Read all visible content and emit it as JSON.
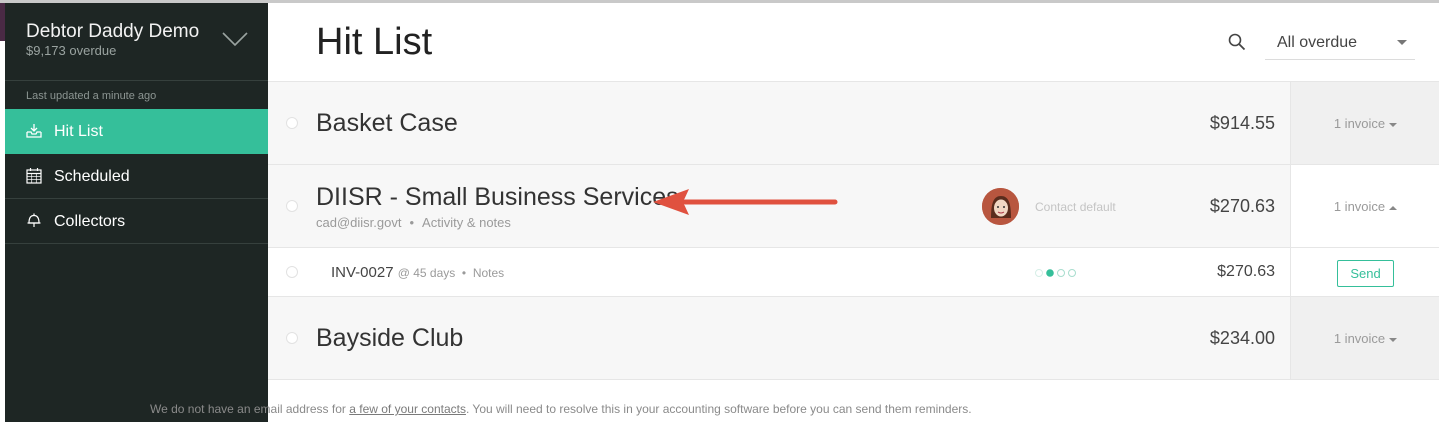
{
  "sidebar": {
    "org_name": "Debtor Daddy Demo",
    "org_overdue": "$9,173 overdue",
    "last_updated": "Last updated a minute ago",
    "items": [
      {
        "label": "Hit List",
        "icon": "inbox-icon",
        "active": true
      },
      {
        "label": "Scheduled",
        "icon": "calendar-icon",
        "active": false
      },
      {
        "label": "Collectors",
        "icon": "bell-icon",
        "active": false
      }
    ]
  },
  "header": {
    "title": "Hit List",
    "filter_value": "All overdue"
  },
  "rows": [
    {
      "name": "Basket Case",
      "amount": "$914.55",
      "invoice_toggle": "1 invoice"
    },
    {
      "name": "DIISR - Small Business Services",
      "email": "cad@diisr.govt",
      "activity": "Activity & notes",
      "contact_default": "Contact default",
      "amount": "$270.63",
      "invoice_toggle": "1 invoice"
    },
    {
      "name": "Bayside Club",
      "amount": "$234.00",
      "invoice_toggle": "1 invoice"
    }
  ],
  "invoice": {
    "number": "INV-0027",
    "age": "@ 45 days",
    "notes": "Notes",
    "amount": "$270.63",
    "send_label": "Send"
  },
  "footer": {
    "prefix": "We do not have an email address for ",
    "link": "a few of your contacts",
    "suffix": ". You will need to resolve this in your accounting software before you can send them reminders."
  },
  "colors": {
    "accent": "#35bf9a",
    "sidebar_bg": "#1e2624",
    "arrow": "#e0513f"
  }
}
